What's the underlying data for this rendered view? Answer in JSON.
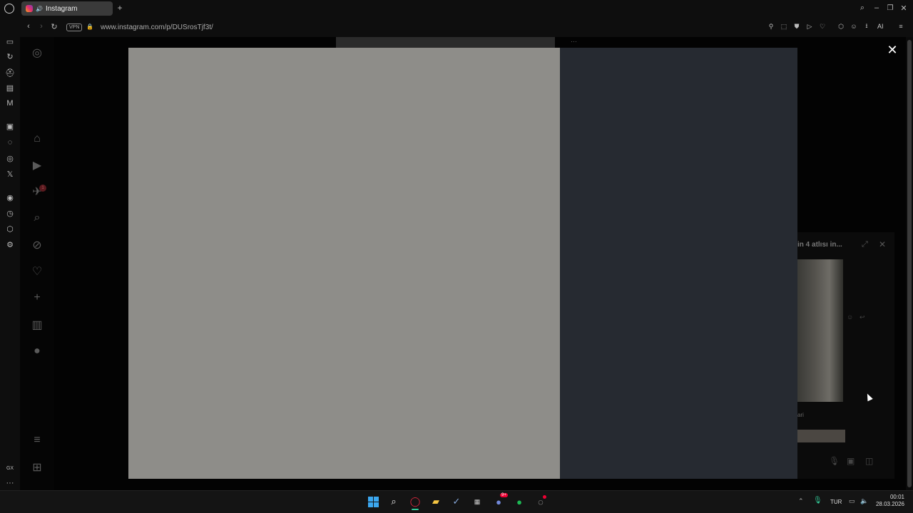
{
  "browser": {
    "tab_title": "Instagram",
    "new_tab_symbol": "+",
    "url": "www.instagram.com/p/DUSrosTjf3t/",
    "vpn_label": "VPN",
    "ai_label": "AI",
    "window_controls": [
      "search-icon",
      "minimize-icon",
      "snapshot-icon",
      "close-icon"
    ]
  },
  "opera_sidebar": {
    "gx_label": "GX",
    "more_label": "···"
  },
  "instagram_nav": {
    "notification_badge": "1"
  },
  "modal": {
    "close_symbol": "✕",
    "media_color": "#8e8d89",
    "side_color": "#262a31"
  },
  "chat": {
    "title": "in 4 atlısı in...",
    "sender_fragment": "ari",
    "close_symbol": "✕",
    "expand_symbol": "⤢"
  },
  "bg": {
    "top_dots": "···"
  },
  "taskbar": {
    "language": "TUR",
    "time": "00:01",
    "date": "28.03.2026",
    "discord_badge": "9+"
  }
}
